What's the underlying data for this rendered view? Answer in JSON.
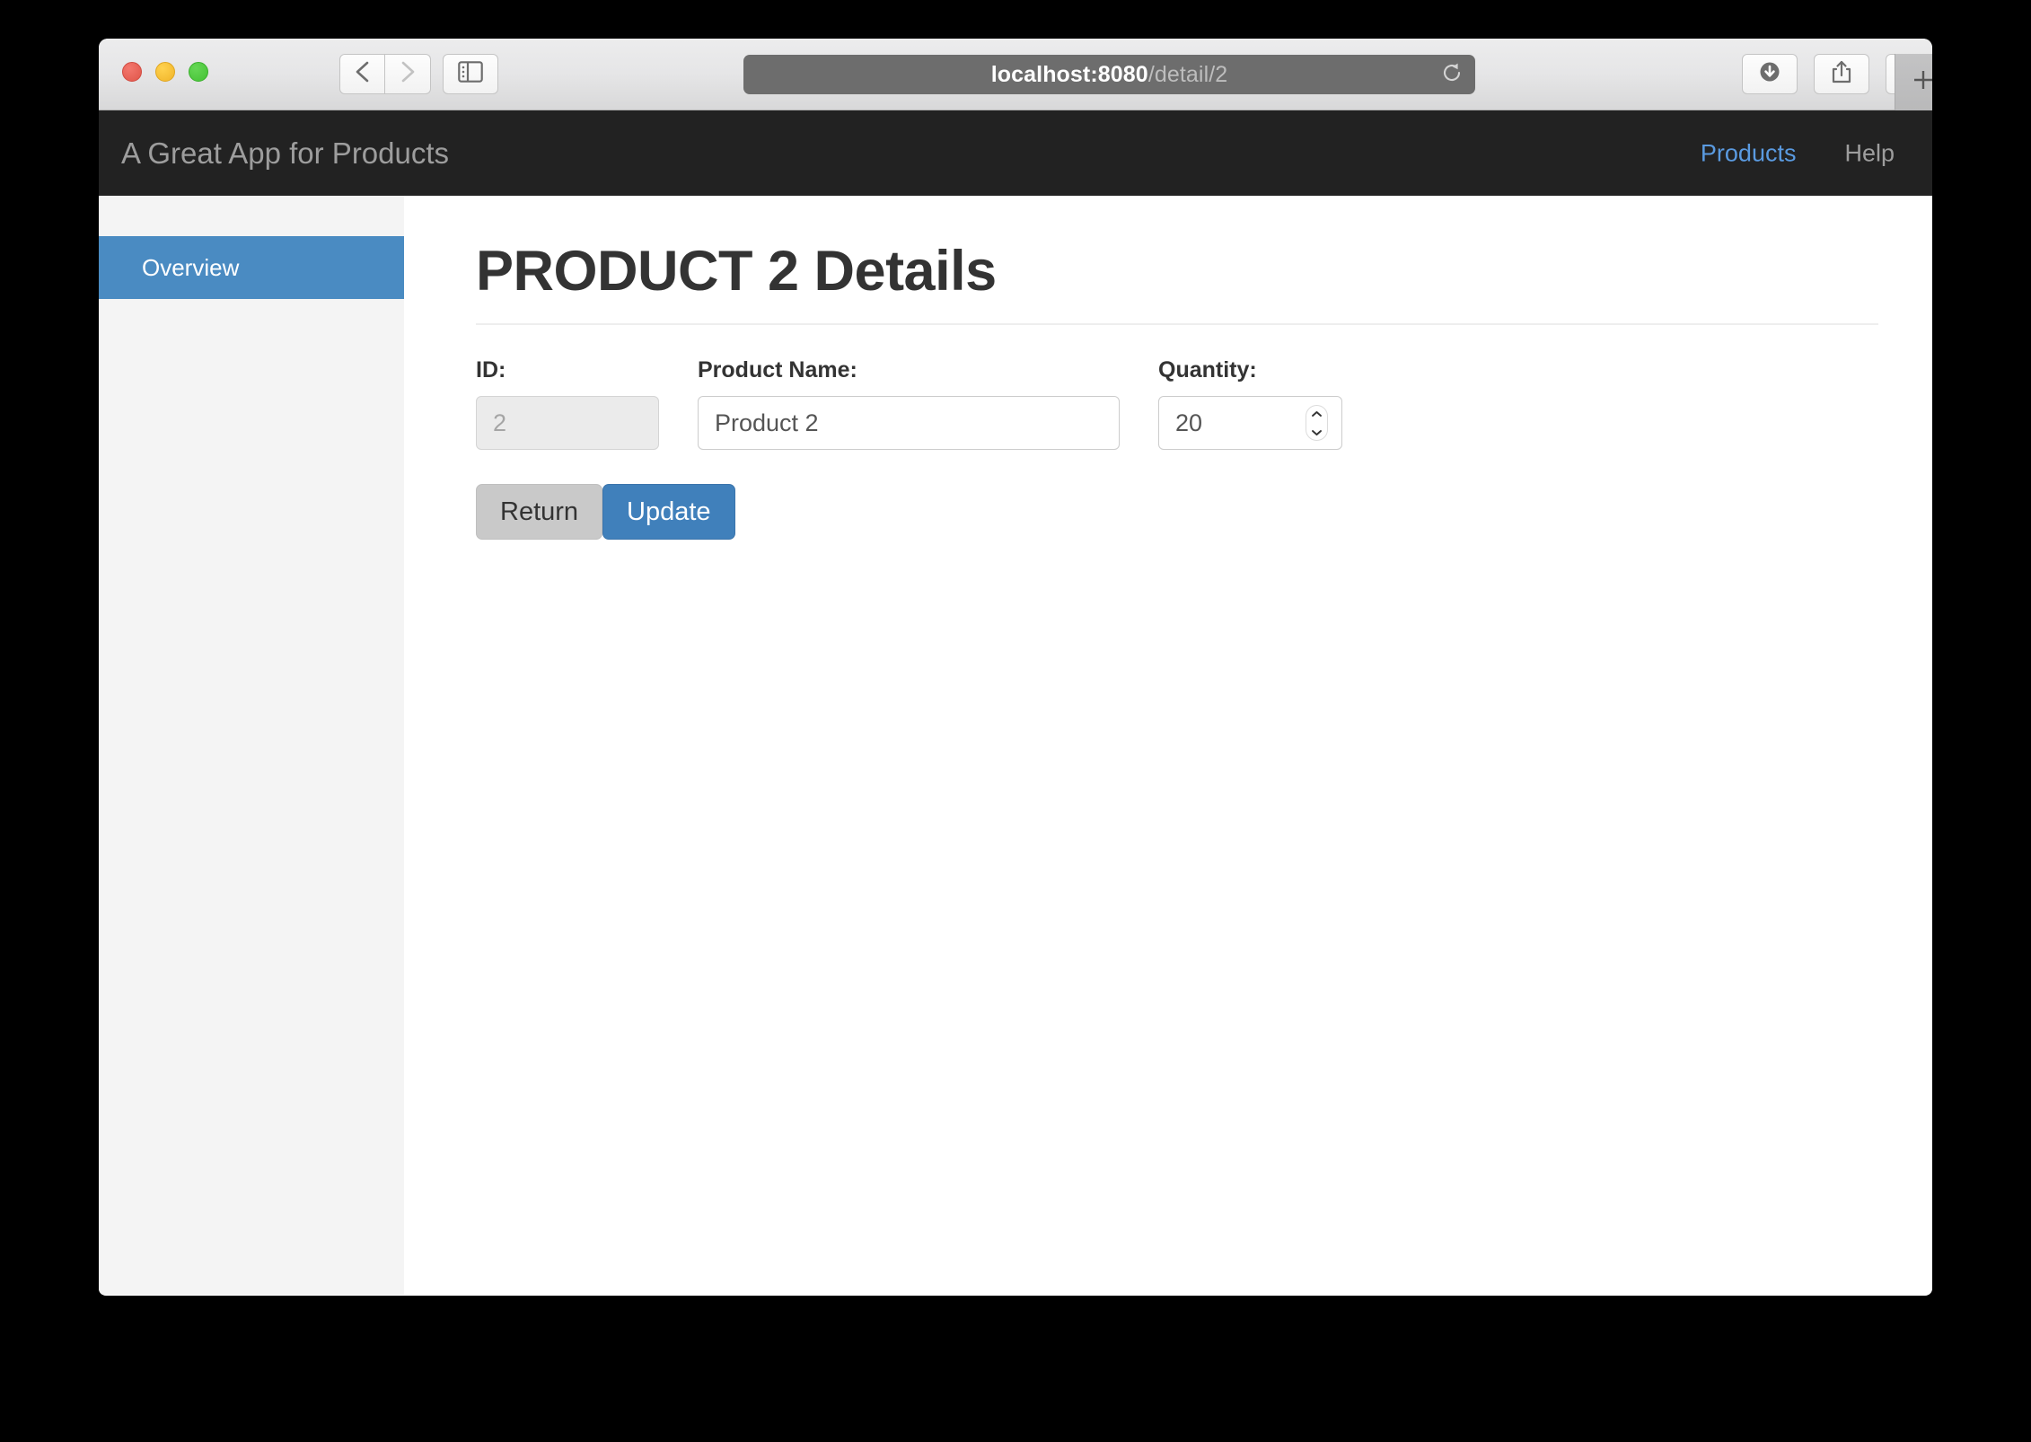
{
  "browser": {
    "url": {
      "host": "localhost:8080",
      "path": "/detail/2"
    },
    "controls": {
      "close": "close-window",
      "minimize": "minimize-window",
      "maximize": "maximize-window",
      "back": "back",
      "forward": "forward",
      "sidebar": "show-sidebar",
      "reload": "reload",
      "downloads": "downloads",
      "share": "share",
      "tab_overview": "tab-overview",
      "new_tab": "+"
    }
  },
  "navbar": {
    "brand": "A Great App for Products",
    "links": [
      {
        "label": "Products",
        "active": true
      },
      {
        "label": "Help",
        "active": false
      }
    ]
  },
  "sidebar": {
    "items": [
      {
        "label": "Overview",
        "active": true
      }
    ]
  },
  "main": {
    "page_title": "PRODUCT 2 Details",
    "fields": [
      {
        "label": "ID:",
        "value": "2",
        "disabled": true
      },
      {
        "label": "Product Name:",
        "value": "Product 2",
        "disabled": false
      },
      {
        "label": "Quantity:",
        "value": "20",
        "disabled": false
      }
    ],
    "buttons": [
      {
        "label": "Return",
        "style": "default"
      },
      {
        "label": "Update",
        "style": "primary"
      }
    ]
  },
  "colors": {
    "navbar_bg": "#222222",
    "accent_blue": "#4a8bc2",
    "link_blue": "#5a9ae0",
    "sidebar_bg": "#f4f4f4",
    "btn_default_bg": "#c9c9c9",
    "btn_primary_bg": "#4080bb"
  }
}
